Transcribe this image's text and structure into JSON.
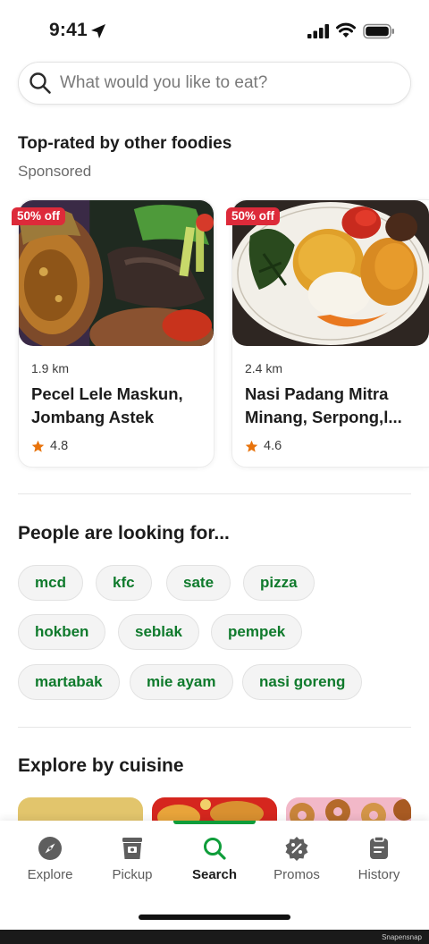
{
  "status_bar": {
    "time": "9:41"
  },
  "search": {
    "placeholder": "What would you like to eat?"
  },
  "top_rated": {
    "title": "Top-rated by other foodies",
    "subtitle": "Sponsored",
    "cards": [
      {
        "badge": "50% off",
        "distance": "1.9 km",
        "name": "Pecel Lele Maskun, Jombang Astek",
        "rating": "4.8"
      },
      {
        "badge": "50% off",
        "distance": "2.4 km",
        "name": "Nasi Padang Mitra Minang, Serpong,l...",
        "rating": "4.6"
      }
    ]
  },
  "looking_for": {
    "title": "People are looking for...",
    "chips": [
      "mcd",
      "kfc",
      "sate",
      "pizza",
      "hokben",
      "seblak",
      "pempek",
      "martabak",
      "mie ayam",
      "nasi goreng"
    ]
  },
  "cuisine": {
    "title": "Explore by cuisine"
  },
  "nav": {
    "items": [
      {
        "label": "Explore",
        "icon": "compass-icon"
      },
      {
        "label": "Pickup",
        "icon": "pickup-bag-icon"
      },
      {
        "label": "Search",
        "icon": "search-icon"
      },
      {
        "label": "Promos",
        "icon": "percent-badge-icon"
      },
      {
        "label": "History",
        "icon": "receipt-icon"
      }
    ],
    "active": "Search"
  },
  "colors": {
    "accent": "#0f9d3a",
    "chip_text": "#0f7a2c",
    "badge": "#dd2a3a",
    "star": "#e8730c"
  },
  "watermark": "Snapensnap"
}
